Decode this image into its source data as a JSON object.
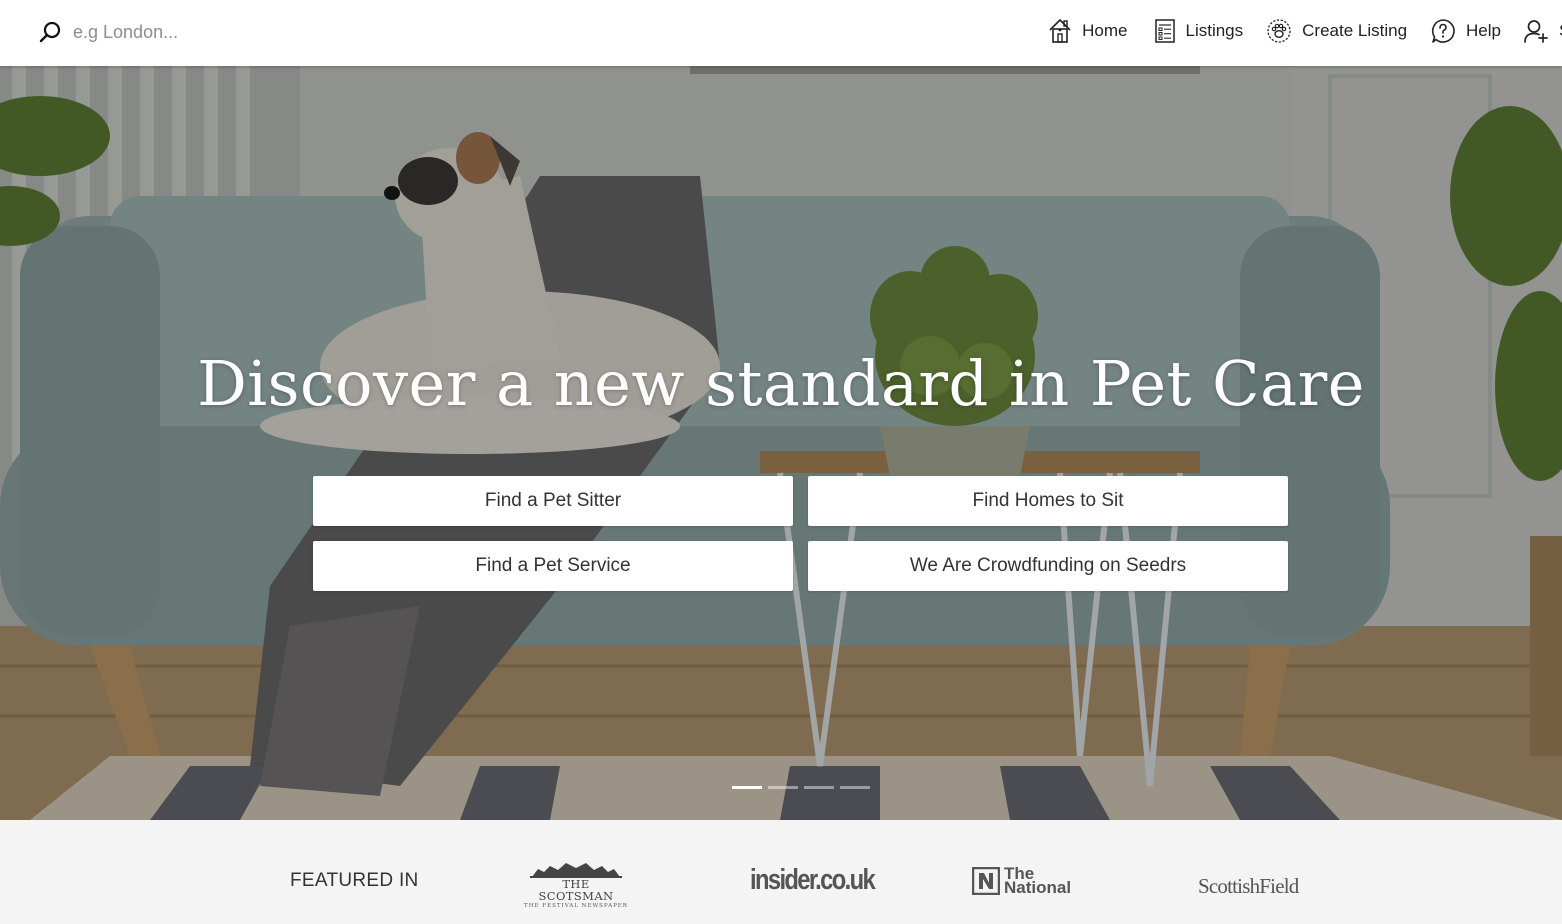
{
  "search": {
    "placeholder": "e.g London..."
  },
  "nav": {
    "home": "Home",
    "listings": "Listings",
    "create_listing": "Create Listing",
    "help": "Help",
    "account": "S"
  },
  "hero": {
    "title": "Discover a new standard in Pet Care",
    "buttons": [
      {
        "label": "Find a Pet Sitter"
      },
      {
        "label": "Find Homes to Sit"
      },
      {
        "label": "Find a Pet Service"
      },
      {
        "label": "We Are Crowdfunding on Seedrs"
      }
    ],
    "slides": {
      "count": 4,
      "active": 1
    }
  },
  "featured": {
    "label": "FEATURED IN",
    "logos": {
      "scotsman_name": "THE SCOTSMAN",
      "scotsman_tag": "THE FESTIVAL NEWSPAPER",
      "insider": "insider.co.uk",
      "national_line1": "The",
      "national_line2": "National",
      "scottish_field": "ScottishField"
    }
  },
  "icons": [
    "search-icon",
    "home-icon",
    "listings-icon",
    "paw-icon",
    "help-icon",
    "add-user-icon"
  ],
  "colors": {
    "text": "#222222",
    "button_bg": "#ffffff",
    "featured_bg": "#f4f4f4"
  }
}
